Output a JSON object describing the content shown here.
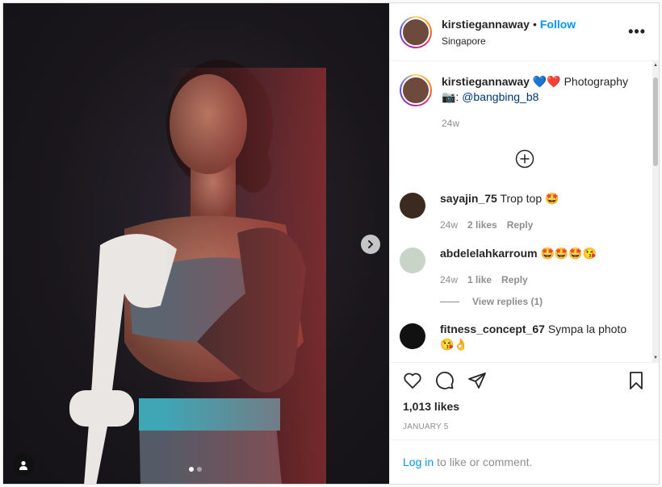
{
  "post": {
    "username": "kirstiegannaway",
    "separator": "•",
    "follow_label": "Follow",
    "location": "Singapore",
    "more_label": "•••",
    "photo_dots": 2,
    "active_dot": 0
  },
  "caption": {
    "username": "kirstiegannaway",
    "text_before_mention": "💙❤️ Photography 📷: ",
    "mention": "@bangbing_b8",
    "time": "24w"
  },
  "comments": [
    {
      "username": "sayajin_75",
      "text": "Trop top 🤩",
      "time": "24w",
      "likes": "2 likes",
      "reply_label": "Reply",
      "avatar_color": "#3b2a1f"
    },
    {
      "username": "abdelelahkarroum",
      "text": "🤩🤩🤩😘",
      "time": "24w",
      "likes": "1 like",
      "reply_label": "Reply",
      "avatar_color": "#c9d4c8",
      "view_replies": "View replies (1)"
    },
    {
      "username": "fitness_concept_67",
      "text": "Sympa la photo 😘👌",
      "avatar_color": "#111111"
    }
  ],
  "actions": {
    "likes": "1,013 likes",
    "date": "JANUARY 5"
  },
  "login": {
    "link": "Log in",
    "text": "to like or comment."
  },
  "colors": {
    "accent": "#0095f6",
    "muted": "#8e8e8e",
    "text": "#262626"
  }
}
